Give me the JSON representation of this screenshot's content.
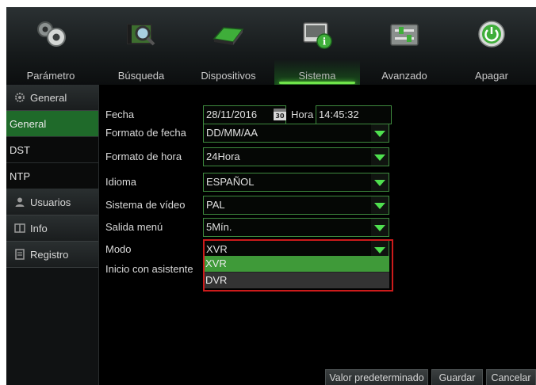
{
  "toolbar": {
    "items": [
      {
        "label": "Parámetro",
        "icon": "gears-icon"
      },
      {
        "label": "Búsqueda",
        "icon": "film-search-icon"
      },
      {
        "label": "Dispositivos",
        "icon": "hard-drive-icon"
      },
      {
        "label": "Sistema",
        "icon": "system-info-icon"
      },
      {
        "label": "Avanzado",
        "icon": "sliders-icon"
      },
      {
        "label": "Apagar",
        "icon": "power-icon"
      }
    ],
    "active": "Sistema"
  },
  "sidebar": {
    "general": "General",
    "sub_general": "General",
    "sub_dst": "DST",
    "sub_ntp": "NTP",
    "usuarios": "Usuarios",
    "info": "Info",
    "registro": "Registro"
  },
  "form": {
    "fecha_label": "Fecha",
    "fecha_value": "28/11/2016",
    "cal_day": "30",
    "hora_label": "Hora",
    "hora_value": "14:45:32",
    "formato_fecha_label": "Formato de fecha",
    "formato_fecha_value": "DD/MM/AA",
    "formato_hora_label": "Formato de hora",
    "formato_hora_value": "24Hora",
    "idioma_label": "Idioma",
    "idioma_value": "ESPAÑOL",
    "sistema_video_label": "Sistema de vídeo",
    "sistema_video_value": "PAL",
    "salida_menu_label": "Salida menú",
    "salida_menu_value": "5Mín.",
    "modo_label": "Modo",
    "modo_value": "XVR",
    "modo_options": [
      "XVR",
      "DVR"
    ],
    "inicio_label": "Inicio con asistente"
  },
  "buttons": {
    "default": "Valor predeterminado",
    "save": "Guardar",
    "cancel": "Cancelar"
  },
  "colors": {
    "accent_green": "#3f9a39",
    "highlight_red": "#cc1b1b"
  }
}
